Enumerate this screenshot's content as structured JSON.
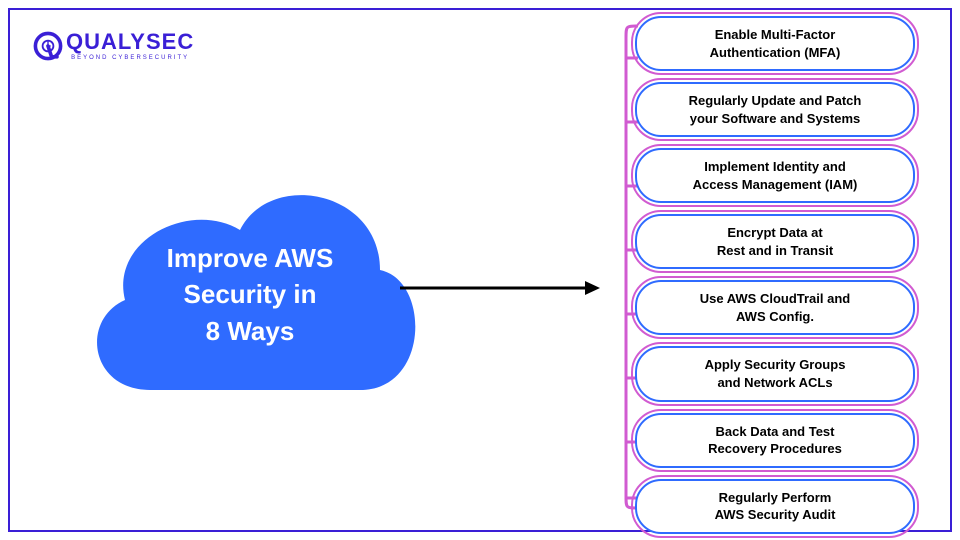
{
  "logo": {
    "main": "QUALYSEC",
    "sub": "BEYOND CYBERSECURITY"
  },
  "cloud": {
    "title": "Improve AWS\nSecurity in\n8 Ways",
    "fill": "#2f6bff"
  },
  "items": [
    "Enable Multi-Factor\nAuthentication (MFA)",
    "Regularly Update and Patch\nyour Software and Systems",
    "Implement Identity and\nAccess Management (IAM)",
    "Encrypt Data at\nRest and in Transit",
    "Use AWS CloudTrail and\nAWS Config.",
    "Apply Security Groups\nand Network ACLs",
    "Back Data and Test\nRecovery Procedures",
    "Regularly Perform\nAWS Security Audit"
  ],
  "colors": {
    "frame": "#3a1fd6",
    "pillBorder": "#2f6bff",
    "pillOutline": "#d15bd1",
    "bracket": "#d15bd1"
  }
}
